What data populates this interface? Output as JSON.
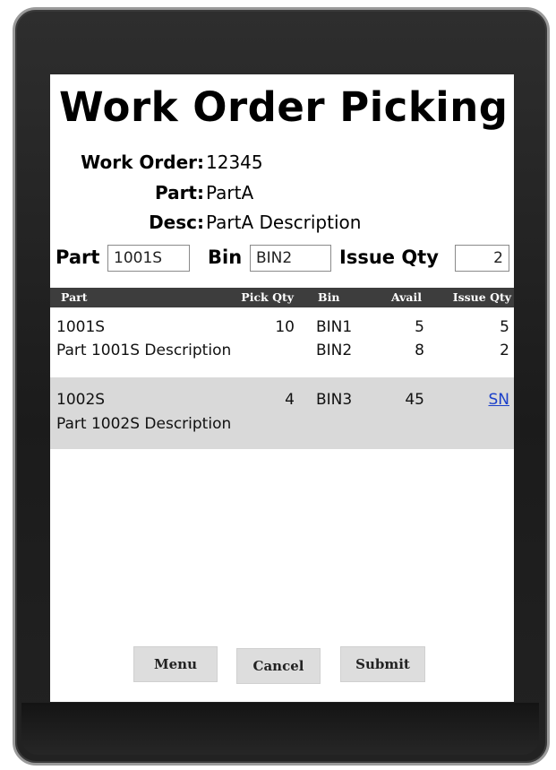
{
  "title": "Work Order Picking",
  "info": {
    "work_order_label": "Work Order:",
    "work_order_value": "12345",
    "part_label": "Part:",
    "part_value": "PartA",
    "desc_label": "Desc:",
    "desc_value": "PartA Description"
  },
  "fields": {
    "part_label": "Part",
    "part_value": "1001S",
    "bin_label": "Bin",
    "bin_value": "BIN2",
    "qty_label": "Issue Qty",
    "qty_value": "2"
  },
  "grid": {
    "headers": [
      "Part",
      "Pick Qty",
      "Bin",
      "Avail",
      "Issue Qty"
    ],
    "rows": [
      {
        "part": "1001S",
        "description": "Part 1001S Description",
        "pick_qty": "10",
        "bins": [
          {
            "bin": "BIN1",
            "avail": "5",
            "issue_qty": "5"
          },
          {
            "bin": "BIN2",
            "avail": "8",
            "issue_qty": "2"
          }
        ]
      },
      {
        "part": "1002S",
        "description": "Part 1002S Description",
        "pick_qty": "4",
        "bins": [
          {
            "bin": "BIN3",
            "avail": "45",
            "issue_qty": "SN"
          }
        ]
      }
    ]
  },
  "buttons": {
    "menu": "Menu",
    "cancel": "Cancel",
    "submit": "Submit"
  },
  "colors": {
    "header_bg": "#3d3d3d",
    "alt_row_bg": "#d9d9d9",
    "link": "#1a3fc9",
    "button_bg": "#dddddd"
  }
}
